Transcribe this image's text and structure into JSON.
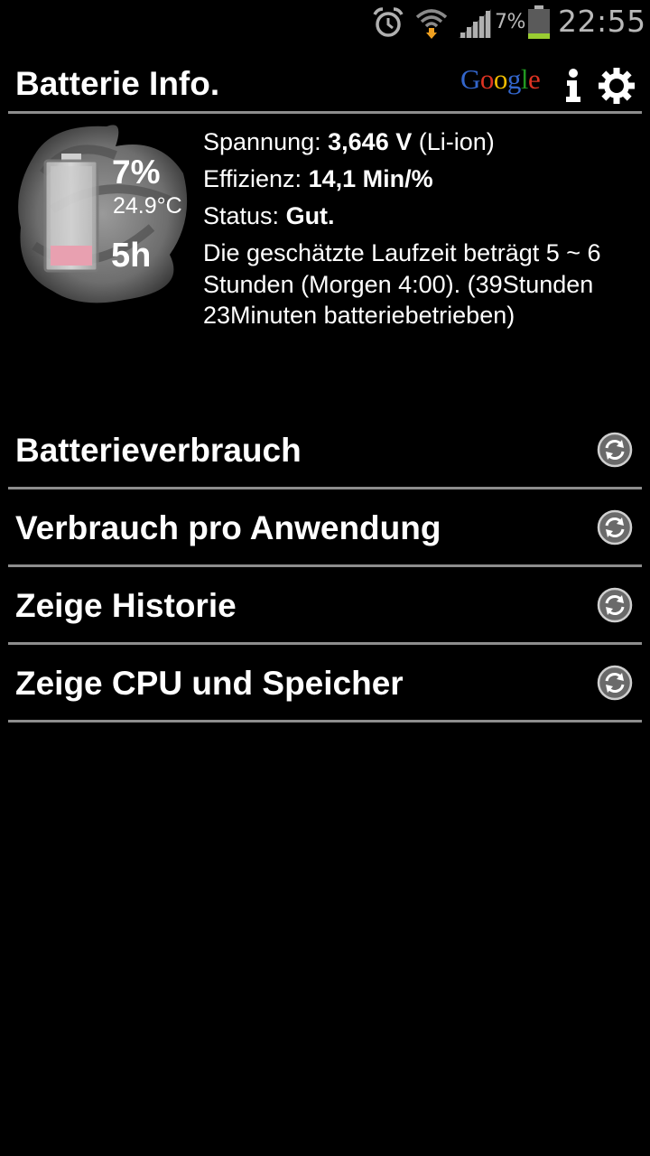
{
  "status_bar": {
    "icons": [
      "alarm-icon",
      "wifi-icon",
      "signal-icon",
      "battery-icon"
    ],
    "battery_percent": "7%",
    "time": "22:55",
    "battery_color": "#9acd32"
  },
  "header": {
    "title": "Batterie Info.",
    "google_letters": [
      {
        "ch": "G",
        "color": "#3366cc"
      },
      {
        "ch": "o",
        "color": "#dd3322"
      },
      {
        "ch": "o",
        "color": "#eebb00"
      },
      {
        "ch": "g",
        "color": "#3366cc"
      },
      {
        "ch": "l",
        "color": "#229922"
      },
      {
        "ch": "e",
        "color": "#dd3322"
      }
    ],
    "icons": [
      "info-icon",
      "gear-icon"
    ]
  },
  "battery_widget": {
    "level": 0.07,
    "percent": "7%",
    "temperature": "24.9°C",
    "remaining": "5h",
    "fill_color": "#e8a0b0"
  },
  "details": {
    "voltage_label": "Spannung:",
    "voltage_value": "3,646 V",
    "voltage_type": "(Li-ion)",
    "efficiency_label": "Effizienz:",
    "efficiency_value": "14,1 Min/%",
    "status_label": "Status:",
    "status_value": "Gut.",
    "estimate": "Die geschätzte Laufzeit beträgt 5 ~ 6 Stunden (Morgen 4:00). (39Stunden 23Minuten batteriebetrieben)"
  },
  "menu": {
    "items": [
      {
        "label": "Batterieverbrauch",
        "icon": "refresh-icon"
      },
      {
        "label": "Verbrauch pro Anwendung",
        "icon": "refresh-icon"
      },
      {
        "label": "Zeige Historie",
        "icon": "refresh-icon"
      },
      {
        "label": "Zeige CPU und Speicher",
        "icon": "refresh-icon"
      }
    ]
  }
}
